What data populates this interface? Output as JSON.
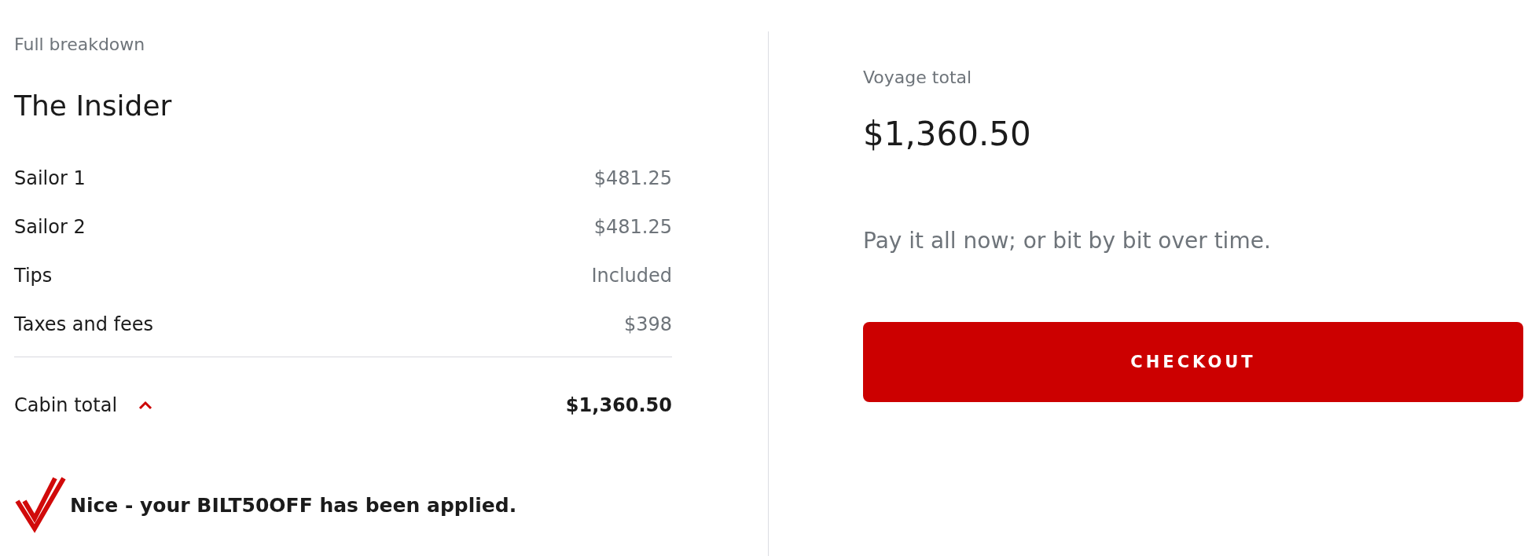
{
  "breakdown": {
    "heading": "Full breakdown",
    "title": "The Insider",
    "items": [
      {
        "label": "Sailor 1",
        "price": "$481.25"
      },
      {
        "label": "Sailor 2",
        "price": "$481.25"
      },
      {
        "label": "Tips",
        "price": "Included"
      },
      {
        "label": "Taxes and fees",
        "price": "$398"
      }
    ],
    "cabin_total": {
      "label": "Cabin total",
      "amount": "$1,360.50",
      "expanded": true
    },
    "promo": {
      "message": "Nice - your BILT50OFF has been applied."
    }
  },
  "summary": {
    "label": "Voyage total",
    "amount": "$1,360.50",
    "note": "Pay it all now; or bit by bit over time.",
    "button": "CHECKOUT"
  }
}
